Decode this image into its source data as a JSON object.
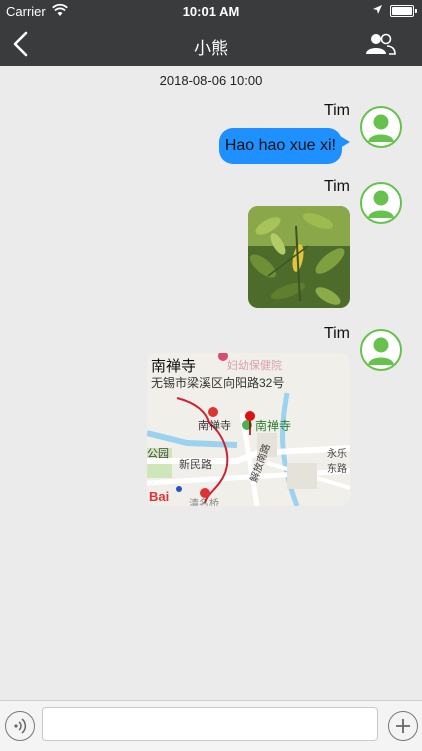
{
  "status_bar": {
    "carrier": "Carrier",
    "time": "10:01 AM"
  },
  "nav": {
    "title": "小熊",
    "back_icon": "chevron-left-icon",
    "contacts_icon": "contacts-icon"
  },
  "chat": {
    "timestamp": "2018-08-06 10:00",
    "messages": [
      {
        "sender": "Tim",
        "type": "text",
        "text": "Hao hao xue xi!"
      },
      {
        "sender": "Tim",
        "type": "image"
      },
      {
        "sender": "Tim",
        "type": "location",
        "place": "南禅寺",
        "address": "无锡市梁溪区向阳路32号",
        "map_labels": {
          "poi": "南禅寺",
          "metro": "南禅寺",
          "road1": "新民路",
          "road2": "解放南路",
          "road3": "永乐东路",
          "logo": "Bai",
          "park": "公园",
          "hospital": "妇幼保健院",
          "bridge": "清名桥"
        }
      }
    ]
  },
  "input_bar": {
    "placeholder": "",
    "voice_icon": "voice-icon",
    "plus_icon": "plus-icon"
  },
  "colors": {
    "nav_bg": "#3a3b3d",
    "bubble": "#1e90ff",
    "avatar_accent": "#66c14d",
    "chat_bg": "#ebebeb"
  }
}
